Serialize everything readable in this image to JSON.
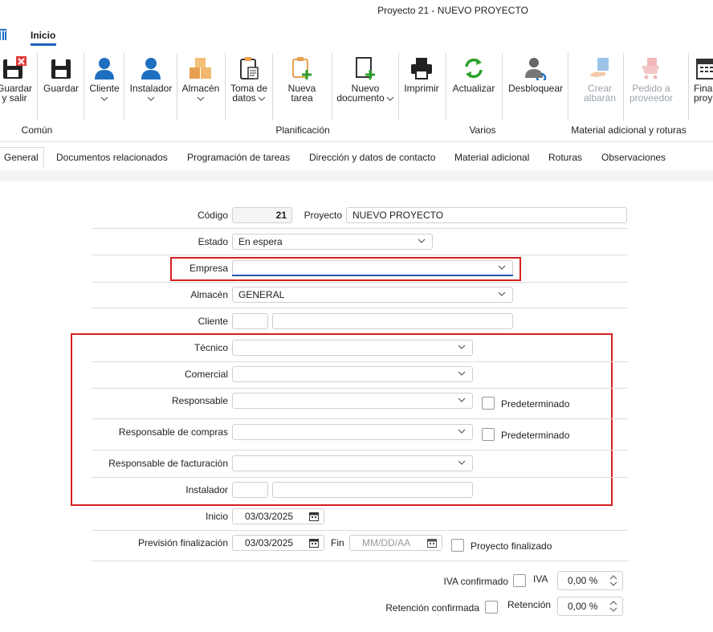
{
  "window": {
    "title": "Proyecto 21 - NUEVO PROYECTO"
  },
  "menu": {
    "tab": "Inicio"
  },
  "ribbon": {
    "buttons": [
      {
        "line1": "Guardar",
        "line2": "y salir"
      },
      {
        "line1": "Guardar",
        "line2": ""
      },
      {
        "line1": "Cliente",
        "line2": ""
      },
      {
        "line1": "Instalador",
        "line2": ""
      },
      {
        "line1": "Almacén",
        "line2": ""
      },
      {
        "line1": "Toma de",
        "line2": "datos"
      },
      {
        "line1": "Nueva",
        "line2": "tarea"
      },
      {
        "line1": "Nuevo",
        "line2": "documento"
      },
      {
        "line1": "Imprimir",
        "line2": ""
      },
      {
        "line1": "Actualizar",
        "line2": ""
      },
      {
        "line1": "Desbloquear",
        "line2": ""
      },
      {
        "line1": "Crear",
        "line2": "albarán"
      },
      {
        "line1": "Pedido a",
        "line2": "proveedor"
      },
      {
        "line1": "Fina",
        "line2": "proy"
      }
    ],
    "groups": {
      "comun": "Común",
      "planificacion": "Planificación",
      "varios": "Varios",
      "material": "Material adicional y roturas"
    }
  },
  "tabs": [
    "General",
    "Documentos relacionados",
    "Programación de tareas",
    "Dirección y datos de contacto",
    "Material adicional",
    "Roturas",
    "Observaciones"
  ],
  "form": {
    "codigo": {
      "label": "Código",
      "value": "21"
    },
    "proyecto": {
      "label": "Proyecto",
      "value": "NUEVO PROYECTO"
    },
    "estado": {
      "label": "Estado",
      "value": "En espera"
    },
    "empresa": {
      "label": "Empresa",
      "value": ""
    },
    "almacen": {
      "label": "Almacén",
      "value": "GENERAL"
    },
    "cliente": {
      "label": "Cliente",
      "code": "",
      "name": ""
    },
    "tecnico": {
      "label": "Técnico",
      "value": ""
    },
    "comercial": {
      "label": "Comercial",
      "value": ""
    },
    "responsable": {
      "label": "Responsable",
      "value": "",
      "default_label": "Predeterminado"
    },
    "responsable_compras": {
      "label": "Responsable de compras",
      "value": "",
      "default_label": "Predeterminado"
    },
    "responsable_facturacion": {
      "label": "Responsable de facturación",
      "value": ""
    },
    "instalador": {
      "label": "Instalador",
      "code": "",
      "name": ""
    },
    "inicio": {
      "label": "Inicio",
      "value": "03/03/2025"
    },
    "prevision": {
      "label": "Previsión finalización",
      "value": "03/03/2025"
    },
    "fin": {
      "label": "Fin",
      "placeholder": "MM/DD/AA"
    },
    "finalizado": {
      "label": "Proyecto finalizado"
    },
    "iva_confirmado": {
      "label": "IVA confirmado"
    },
    "iva": {
      "label": "IVA",
      "value": "0,00 %"
    },
    "retencion_confirmada": {
      "label": "Retención confirmada"
    },
    "retencion": {
      "label": "Retención",
      "value": "0,00 %"
    }
  }
}
